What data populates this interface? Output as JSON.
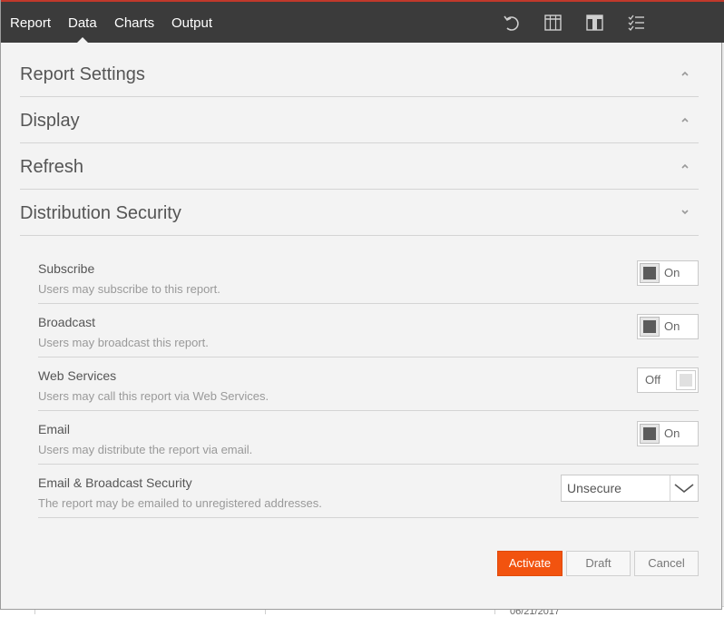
{
  "app": {
    "nav_tabs": [
      {
        "label": "Report",
        "active": false
      },
      {
        "label": "Data",
        "active": true
      },
      {
        "label": "Charts",
        "active": false
      },
      {
        "label": "Output",
        "active": false
      }
    ],
    "toolbar_icons": [
      "undo-icon",
      "table-columns-icon",
      "layout-column-icon",
      "checklist-icon"
    ]
  },
  "sections": [
    {
      "title": "Report Settings",
      "expanded": false
    },
    {
      "title": "Display",
      "expanded": false
    },
    {
      "title": "Refresh",
      "expanded": false
    },
    {
      "title": "Distribution Security",
      "expanded": true
    }
  ],
  "distribution_security": {
    "rows": [
      {
        "title": "Subscribe",
        "description": "Users may subscribe to this report.",
        "control": "toggle",
        "state": "On"
      },
      {
        "title": "Broadcast",
        "description": "Users may broadcast this report.",
        "control": "toggle",
        "state": "On"
      },
      {
        "title": "Web Services",
        "description": "Users may call this report via Web Services.",
        "control": "toggle",
        "state": "Off"
      },
      {
        "title": "Email",
        "description": "Users may distribute the report via email.",
        "control": "toggle",
        "state": "On"
      },
      {
        "title": "Email & Broadcast Security",
        "description": "The report may be emailed to unregistered addresses.",
        "control": "select",
        "value": "Unsecure"
      }
    ]
  },
  "actions": {
    "activate_label": "Activate",
    "draft_label": "Draft",
    "cancel_label": "Cancel"
  },
  "background": {
    "peek_text": "06/21/2017"
  },
  "colors": {
    "topbar": "#3b3b3b",
    "topbar_accent": "#c0392b",
    "primary_button": "#f2530f",
    "panel": "#f3f3f3"
  }
}
